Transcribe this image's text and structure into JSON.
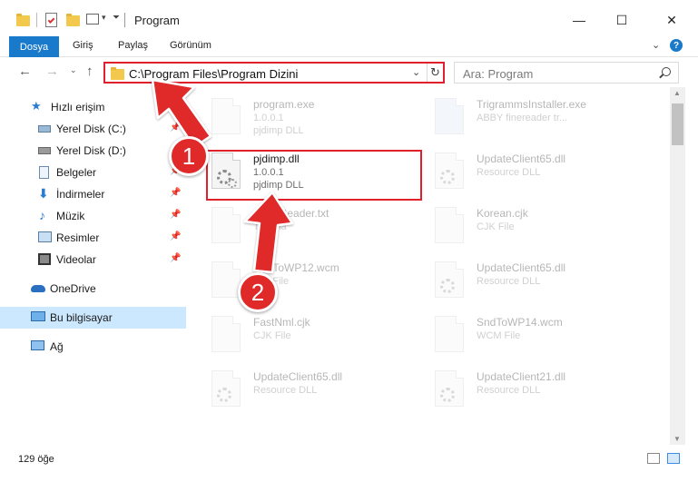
{
  "window": {
    "title": "Program",
    "minimize_glyph": "—",
    "maximize_glyph": "☐",
    "close_glyph": "✕"
  },
  "ribbon": {
    "tabs": [
      {
        "label": "Dosya",
        "active": true
      },
      {
        "label": "Giriş"
      },
      {
        "label": "Paylaş"
      },
      {
        "label": "Görünüm"
      }
    ],
    "help_label": "?"
  },
  "nav": {
    "address": "C:\\Program Files\\Program Dizini",
    "search_placeholder": "Ara: Program"
  },
  "sidebar": {
    "items": [
      {
        "label": "Hızlı erişim",
        "icon": "star-icon"
      },
      {
        "label": "Yerel Disk (C:)",
        "icon": "drive-icon",
        "pinned": true
      },
      {
        "label": "Yerel Disk (D:)",
        "icon": "drive-icon",
        "pinned": true
      },
      {
        "label": "Belgeler",
        "icon": "document-icon",
        "pinned": true
      },
      {
        "label": "İndirmeler",
        "icon": "download-icon",
        "pinned": true
      },
      {
        "label": "Müzik",
        "icon": "music-icon",
        "pinned": true
      },
      {
        "label": "Resimler",
        "icon": "picture-icon",
        "pinned": true
      },
      {
        "label": "Videolar",
        "icon": "video-icon",
        "pinned": true
      },
      {
        "label": "OneDrive",
        "icon": "cloud-icon"
      },
      {
        "label": "Bu bilgisayar",
        "icon": "computer-icon",
        "selected": true
      },
      {
        "label": "Ağ",
        "icon": "network-icon"
      }
    ]
  },
  "files": [
    {
      "name": "program.exe",
      "line1": "1.0.0.1",
      "line2": "pjdimp DLL",
      "faded": true
    },
    {
      "name": "TrigrammsInstaller.exe",
      "line1": "ABBY finereader tr...",
      "line2": "",
      "faded": true
    },
    {
      "name": "pjdimp.dll",
      "line1": "1.0.0.1",
      "line2": "pjdimp DLL",
      "faded": false
    },
    {
      "name": "UpdateClient65.dll",
      "line1": "Resource DLL",
      "line2": "",
      "faded": true
    },
    {
      "name": "...lineReader.txt",
      "line1": "Tt...Fila",
      "line2": "",
      "faded": true
    },
    {
      "name": "Korean.cjk",
      "line1": "CJK File",
      "line2": "",
      "faded": true
    },
    {
      "name": "SndToWP12.wcm",
      "line1": "...M File",
      "line2": "",
      "faded": true
    },
    {
      "name": "UpdateClient65.dll",
      "line1": "Resource DLL",
      "line2": "",
      "faded": true
    },
    {
      "name": "FastNml.cjk",
      "line1": "CJK File",
      "line2": "",
      "faded": true
    },
    {
      "name": "SndToWP14.wcm",
      "line1": "WCM File",
      "line2": "",
      "faded": true
    },
    {
      "name": "UpdateClient65.dll",
      "line1": "Resource DLL",
      "line2": "",
      "faded": true
    },
    {
      "name": "UpdateClient21.dll",
      "line1": "Resource DLL",
      "line2": "",
      "faded": true
    }
  ],
  "status": {
    "count": "129 öğe"
  },
  "annotations": {
    "badge1": "1",
    "badge2": "2",
    "color": "#e02a2a"
  }
}
